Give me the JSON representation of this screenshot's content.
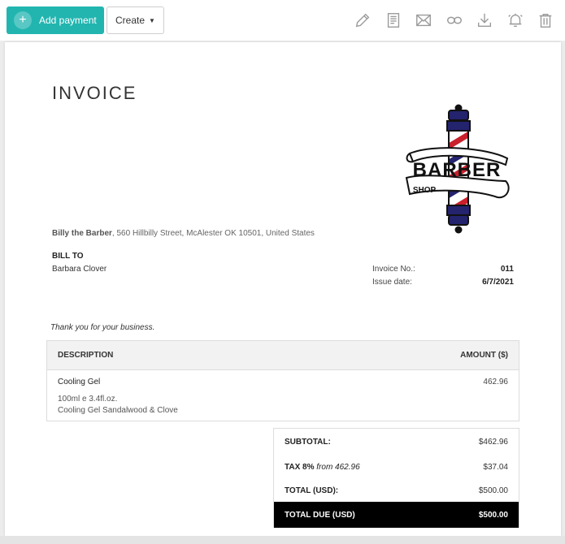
{
  "toolbar": {
    "add_payment_label": "Add payment",
    "create_label": "Create",
    "icons": [
      "pencil-icon",
      "document-icon",
      "envelope-icon",
      "link-icon",
      "download-icon",
      "bell-icon",
      "trash-icon"
    ],
    "accent_color": "#22b5b0"
  },
  "invoice": {
    "title": "INVOICE",
    "logo": {
      "line1": "BARBER",
      "line2": "SHOP"
    },
    "seller_name": "Billy the Barber",
    "seller_address": ", 560 Hillbilly Street, McAlester OK 10501, United States",
    "bill_to_heading": "BILL TO",
    "bill_to_name": "Barbara Clover",
    "invoice_no_label": "Invoice No.:",
    "invoice_no": "011",
    "issue_date_label": "Issue date:",
    "issue_date": "6/7/2021",
    "thanks": "Thank you for your business.",
    "items_header": {
      "description": "DESCRIPTION",
      "amount": "AMOUNT ($)"
    },
    "items": [
      {
        "name": "Cooling Gel",
        "amount": "462.96",
        "detail1": "100ml e 3.4fl.oz.",
        "detail2": "Cooling Gel Sandalwood & Clove"
      }
    ],
    "totals": {
      "subtotal_label": "SUBTOTAL:",
      "subtotal": "$462.96",
      "tax_label": "TAX 8%",
      "tax_from": "from 462.96",
      "tax": "$37.04",
      "total_label": "TOTAL (USD):",
      "total": "$500.00",
      "due_label": "TOTAL DUE (USD)",
      "due": "$500.00"
    }
  }
}
